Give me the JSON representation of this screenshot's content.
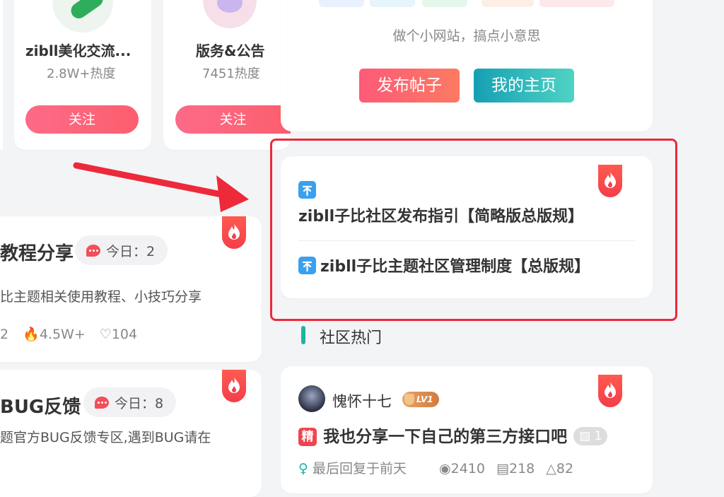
{
  "forums": [
    {
      "name": "zibll美化交流...",
      "hot": "2.8W+热度",
      "follow": "关注"
    },
    {
      "name": "版务&公告",
      "hot": "7451热度",
      "follow": "关注"
    }
  ],
  "profile": {
    "motto": "做个小网站，搞点小意思",
    "post_button": "发布帖子",
    "home_button": "我的主页"
  },
  "announcements": [
    {
      "text": "zibll子比社区发布指引【简略版总版规】"
    },
    {
      "text": "zibll子比主题社区管理制度【总版规】"
    }
  ],
  "boards": [
    {
      "title": "教程分享",
      "today_label": "今日：2",
      "desc": "比主题相关使用教程、小技巧分享",
      "stat_posts": "2",
      "stat_hot": "4.5W+",
      "stat_likes": "104"
    },
    {
      "title": "BUG反馈",
      "today_label": "今日：8",
      "desc": "题官方BUG反馈专区,遇到BUG请在"
    }
  ],
  "section": {
    "title": "社区热门"
  },
  "hot_post": {
    "user": "愧怀十七",
    "level": "LV1",
    "jing": "精",
    "title": "我也分享一下自己的第三方接口吧",
    "img_count": "1",
    "last_reply": "最后回复于前天",
    "views": "2410",
    "comments": "218",
    "likes": "82"
  },
  "colors": {
    "accent": "#fc5f6e",
    "teal": "#1fb5a5",
    "highlight": "#ec2a3a"
  }
}
